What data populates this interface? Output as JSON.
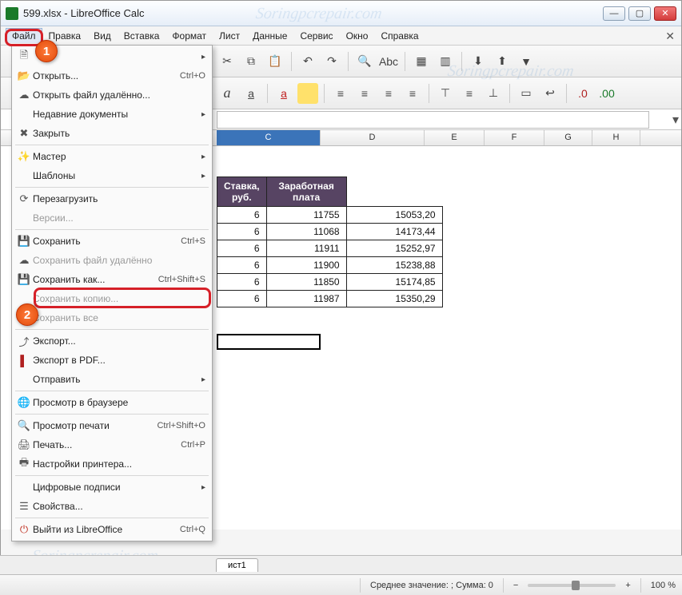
{
  "window": {
    "title": "599.xlsx - LibreOffice Calc"
  },
  "menubar": {
    "items": [
      {
        "label": "Файл",
        "active": true
      },
      {
        "label": "Правка"
      },
      {
        "label": "Вид"
      },
      {
        "label": "Вставка"
      },
      {
        "label": "Формат"
      },
      {
        "label": "Лист"
      },
      {
        "label": "Данные"
      },
      {
        "label": "Сервис"
      },
      {
        "label": "Окно"
      },
      {
        "label": "Справка"
      }
    ]
  },
  "annotations": {
    "badge1": "1",
    "badge2": "2"
  },
  "dropdown": {
    "new_submenu": ">",
    "open_label": "Открыть...",
    "open_sc": "Ctrl+O",
    "open_remote_label": "Открыть файл удалённо...",
    "recent_label": "Недавние документы",
    "close_label": "Закрыть",
    "wizard_label": "Мастер",
    "templates_label": "Шаблоны",
    "reload_label": "Перезагрузить",
    "versions_label": "Версии...",
    "save_label": "Сохранить",
    "save_sc": "Ctrl+S",
    "save_remote_label": "Сохранить файл удалённо",
    "save_as_label": "Сохранить как...",
    "save_as_sc": "Ctrl+Shift+S",
    "save_copy_label": "Сохранить копию...",
    "save_all_label": "Сохранить все",
    "export_label": "Экспорт...",
    "export_pdf_label": "Экспорт в PDF...",
    "send_label": "Отправить",
    "preview_browser_label": "Просмотр в браузере",
    "print_preview_label": "Просмотр печати",
    "print_preview_sc": "Ctrl+Shift+O",
    "print_label": "Печать...",
    "print_sc": "Ctrl+P",
    "printer_settings_label": "Настройки принтера...",
    "signatures_label": "Цифровые подписи",
    "properties_label": "Свойства...",
    "exit_label": "Выйти из LibreOffice",
    "exit_sc": "Ctrl+Q"
  },
  "columns": {
    "C": "C",
    "D": "D",
    "E": "E",
    "F": "F",
    "G": "G",
    "H": "H"
  },
  "table": {
    "header_rate": "Ставка, руб.",
    "header_salary": "Заработная плата",
    "rows": [
      {
        "n": "6",
        "rate": "11755",
        "salary": "15053,20"
      },
      {
        "n": "6",
        "rate": "11068",
        "salary": "14173,44"
      },
      {
        "n": "6",
        "rate": "11911",
        "salary": "15252,97"
      },
      {
        "n": "6",
        "rate": "11900",
        "salary": "15238,88"
      },
      {
        "n": "6",
        "rate": "11850",
        "salary": "15174,85"
      },
      {
        "n": "6",
        "rate": "11987",
        "salary": "15350,29"
      }
    ]
  },
  "tabs": {
    "sheet1": "ист1"
  },
  "statusbar": {
    "stats": "Среднее значение: ; Сумма: 0",
    "zoom": "100 %",
    "minus": "−",
    "plus": "+"
  },
  "watermark": "Soringpcrepair.com"
}
